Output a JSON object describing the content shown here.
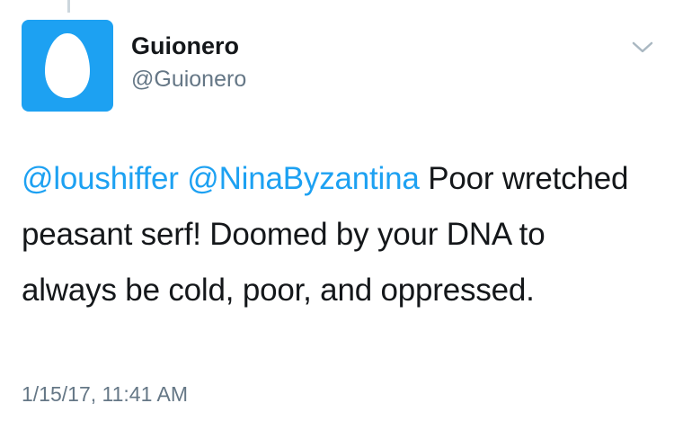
{
  "tweet": {
    "author": {
      "display_name": "Guionero",
      "handle": "@Guionero"
    },
    "mentions": [
      "@loushiffer",
      "@NinaByzantina"
    ],
    "text": "Poor wretched peasant serf! Doomed by your DNA to always be cold, poor, and oppressed.",
    "timestamp": "1/15/17, 11:41 AM"
  },
  "icons": {
    "avatar": "default-egg-avatar",
    "menu": "chevron-down-icon"
  },
  "colors": {
    "accent": "#1da1f2",
    "text": "#14171a",
    "secondary_text": "#657786",
    "thread_line": "#ccd6dd",
    "chevron": "#aab8c2"
  }
}
